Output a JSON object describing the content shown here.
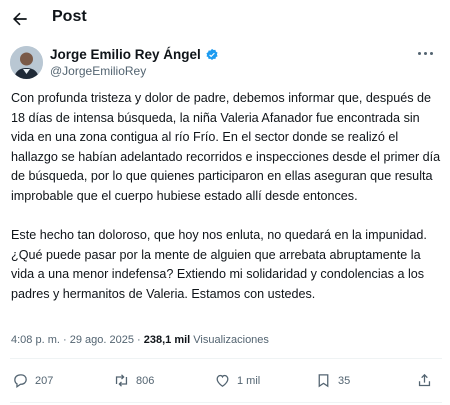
{
  "header": {
    "title": "Post",
    "back_icon": "arrow-left-icon"
  },
  "author": {
    "name": "Jorge Emilio Rey Ángel",
    "handle": "@JorgeEmilioRey",
    "verified_icon": "verified-badge-icon",
    "verified_color": "#1d9bf0"
  },
  "post": {
    "paragraph_1": "Con profunda tristeza y dolor de padre, debemos informar que, después de 18 días de intensa búsqueda, la niña Valeria Afanador fue encontrada sin vida en una zona contigua al río Frío. En el sector donde se realizó el hallazgo se habían adelantado recorridos e inspecciones desde el primer día de búsqueda, por lo que quienes participaron en ellas aseguran que resulta improbable que el cuerpo hubiese estado allí desde entonces.",
    "paragraph_2": "Este hecho tan doloroso, que hoy nos enluta, no quedará en la impunidad. ¿Qué puede pasar por la mente de alguien que arrebata abruptamente la vida a una menor indefensa? Extiendo mi solidaridad y condolencias a los padres y hermanitos de Valeria. Estamos con ustedes."
  },
  "meta": {
    "time": "4:08 p. m.",
    "separator": "·",
    "date": "29 ago. 2025",
    "views_count": "238,1 mil",
    "views_label": "Visualizaciones"
  },
  "actions": {
    "replies": "207",
    "reposts": "806",
    "likes": "1 mil",
    "bookmarks": "35",
    "icons": [
      "reply-icon",
      "repost-icon",
      "like-icon",
      "bookmark-icon",
      "share-icon"
    ]
  }
}
